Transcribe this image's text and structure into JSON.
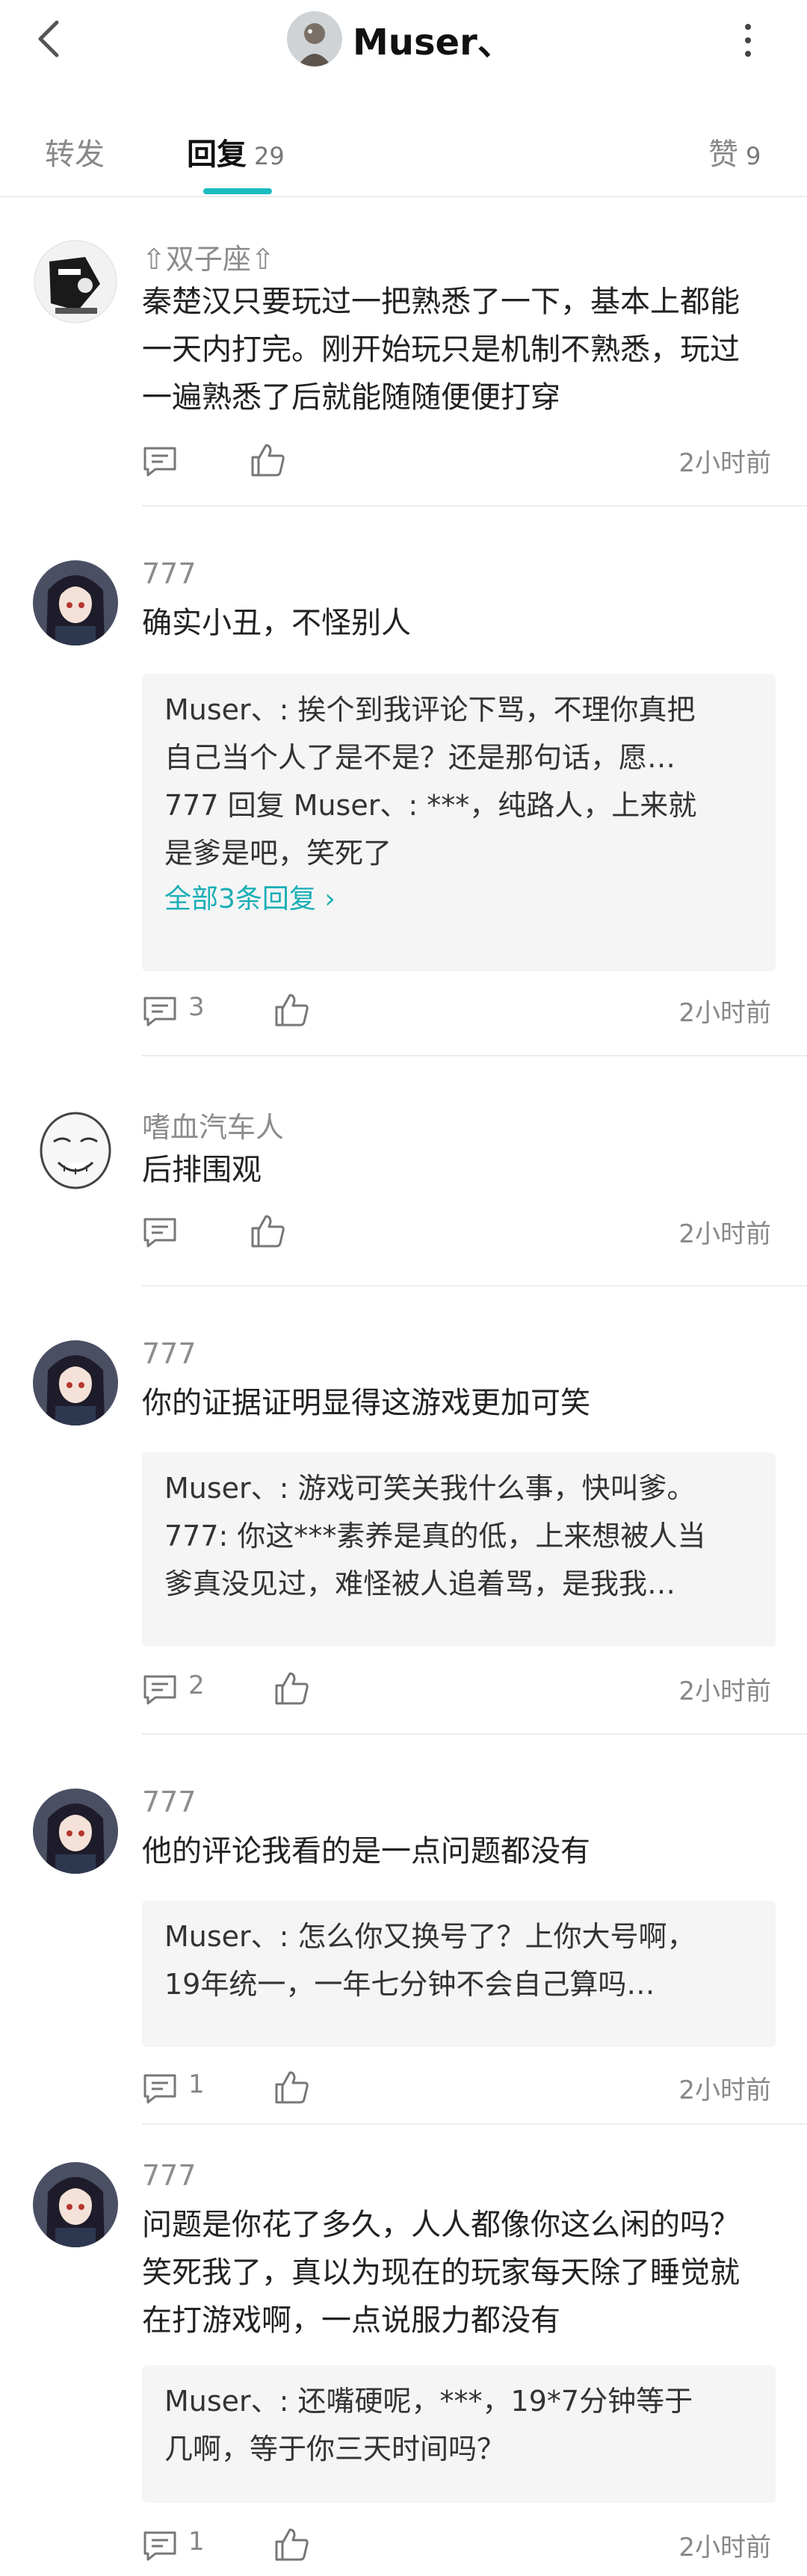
{
  "header": {
    "back_icon": "chevron-left-icon",
    "title": "Muser、",
    "more_icon": "vertical-dots-icon"
  },
  "tabs": [
    {
      "label": "转发",
      "count": ""
    },
    {
      "label": "回复",
      "count": "29"
    },
    {
      "label": "赞",
      "count": "9"
    }
  ],
  "comments": [
    {
      "user": "双子座",
      "user_marks": "⇧双子座⇧",
      "text_lines": [
        "秦楚汉只要玩过一把熟悉了一下，基本上都能",
        "一天内打完。刚开始玩只是机制不熟悉，玩过",
        "一遍熟悉了后就能随随便便打穿"
      ],
      "reply_count": "",
      "time": "2小时前"
    },
    {
      "user": "777",
      "text_lines": [
        "确实小丑，不怪别人"
      ],
      "replies": [
        {
          "name": "Muser、",
          "lines": [
            "Muser、: 挨个到我评论下骂，不理你真把",
            "自己当个人了是不是？还是那句话，愿…"
          ]
        },
        {
          "name": "777 回复 Muser、",
          "lines": [
            "777 回复 Muser、: ***，纯路人，上来就",
            "是爹是吧，笑死了"
          ]
        }
      ],
      "more_replies": "全部3条回复",
      "reply_count": "3",
      "time": "2小时前"
    },
    {
      "user": "嗜血汽车人",
      "text_lines": [
        "后排围观"
      ],
      "reply_count": "",
      "time": "2小时前"
    },
    {
      "user": "777",
      "text_lines": [
        "你的证据证明显得这游戏更加可笑"
      ],
      "replies": [
        {
          "name": "Muser、",
          "lines": [
            "Muser、: 游戏可笑关我什么事，快叫爹。"
          ]
        },
        {
          "name": "777",
          "lines": [
            "777: 你这***素养是真的低，上来想被人当",
            "爹真没见过，难怪被人追着骂，是我我…"
          ]
        }
      ],
      "reply_count": "2",
      "time": "2小时前"
    },
    {
      "user": "777",
      "text_lines": [
        "他的评论我看的是一点问题都没有"
      ],
      "replies": [
        {
          "name": "Muser、",
          "lines": [
            "Muser、: 怎么你又换号了？上你大号啊，",
            "19年统一，一年七分钟不会自己算吗…"
          ]
        }
      ],
      "reply_count": "1",
      "time": "2小时前"
    },
    {
      "user": "777",
      "text_lines": [
        "问题是你花了多久，人人都像你这么闲的吗？",
        "笑死我了，真以为现在的玩家每天除了睡觉就",
        "在打游戏啊，一点说服力都没有"
      ],
      "replies": [
        {
          "name": "Muser、",
          "lines": [
            "Muser、: 还嘴硬呢，***，19*7分钟等于",
            "几啊，等于你三天时间吗？"
          ]
        }
      ],
      "reply_count": "1",
      "time": "2小时前"
    }
  ],
  "icons": {
    "reply": "comment-icon",
    "like": "thumb-up-icon"
  },
  "colors": {
    "accent": "#1bbcc0",
    "link": "#1aaeb6",
    "muted": "#888888"
  }
}
